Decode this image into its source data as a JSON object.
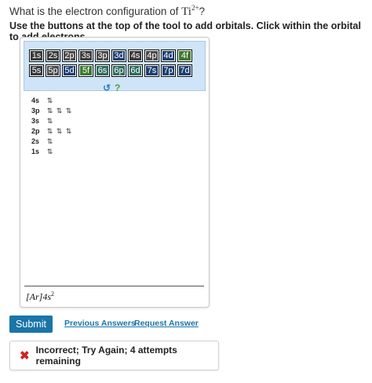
{
  "question": {
    "prefix": "What is the electron configuration of",
    "element": "Ti",
    "charge": "2+",
    "suffix": "?"
  },
  "instructions": "Use the buttons at the top of the tool to add orbitals. Click within the orbital to add electrons.",
  "palette": {
    "row1": [
      "1s",
      "2s",
      "2p",
      "3s",
      "3p",
      "3d",
      "4s",
      "4p",
      "4d",
      "4f"
    ],
    "row2": [
      "5s",
      "5p",
      "5d",
      "5f",
      "6s",
      "6p",
      "6d",
      "7s",
      "7p",
      "7d"
    ]
  },
  "controls": {
    "refresh": "↺",
    "help": "?"
  },
  "diagram": [
    {
      "label": "4s",
      "boxes": [
        "⇅"
      ]
    },
    {
      "label": "3p",
      "boxes": [
        "⇅",
        "⇅",
        "⇅"
      ]
    },
    {
      "label": "3s",
      "boxes": [
        "⇅"
      ]
    },
    {
      "label": "2p",
      "boxes": [
        "⇅",
        "⇅",
        "⇅"
      ]
    },
    {
      "label": "2s",
      "boxes": [
        "⇅"
      ]
    },
    {
      "label": "1s",
      "boxes": [
        "⇅"
      ]
    }
  ],
  "answer": {
    "core": "[Ar]",
    "orbital": "4s",
    "electrons": "2"
  },
  "actions": {
    "submit": "Submit",
    "previous": "Previous Answers",
    "request": "Request Answer"
  },
  "feedback": {
    "text": "Incorrect; Try Again; 4 attempts remaining"
  },
  "colors": {
    "accent": "#1a75a8",
    "error": "#d0241e"
  }
}
